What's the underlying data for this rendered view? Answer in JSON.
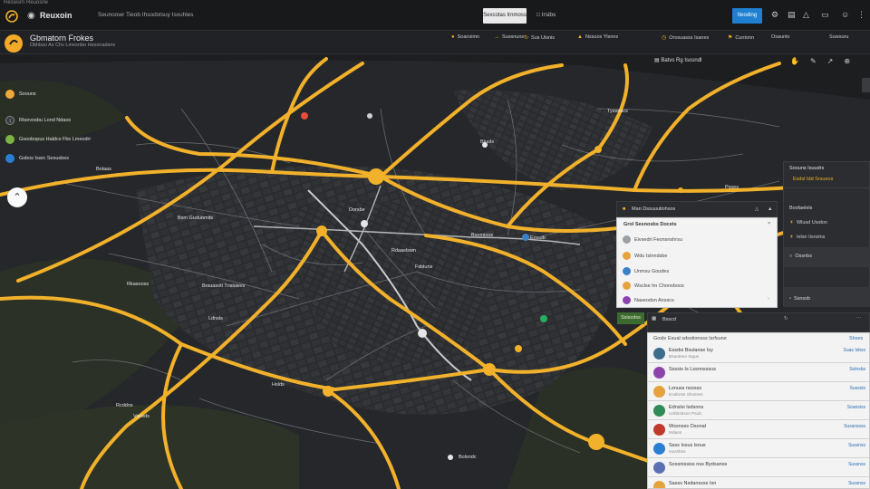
{
  "topbar": {
    "crumb": "Reswsrn Reuosne",
    "app_name": "Reuxoin",
    "subtitle": "Seunoowr Tieob Ihsodstsuy Isxuhles",
    "light_button": "Sexcotas Irnmoss",
    "tab_short": "Irsibs",
    "blue_button": "Iteoding"
  },
  "subheader": {
    "title": "Gbmatorn Frokes",
    "subtitle": "Dbhbso Ax Chv Lmesnbo Hesonadsns",
    "stats": [
      {
        "label": "Soansimn",
        "sub": ""
      },
      {
        "label": "Sussnuns",
        "sub": ""
      },
      {
        "label": "Sus Uisnis",
        "sub": ""
      },
      {
        "label": "Nssuos Ylsnns",
        "sub": ""
      },
      {
        "label": "Orosuasss Isanes",
        "sub": ""
      },
      {
        "label": "Cuntonn",
        "sub": ""
      },
      {
        "label": "Osaunlo",
        "sub": ""
      },
      {
        "label": "Suwsuru",
        "sub": ""
      }
    ]
  },
  "legend": [
    {
      "label": "Soouns",
      "color": "#f2a93b"
    },
    {
      "label": "Rtsevosbu Lond Ndaos",
      "color": "#3a3c40"
    },
    {
      "label": "Gsoobopus Haldcs Fbs Lmeodrr",
      "color": "#7cb342"
    },
    {
      "label": "Gsbos Isarc Sesusbes",
      "color": "#2a7fd4"
    }
  ],
  "map_toolbar": {
    "label": "Batvs Rg  Isosndl"
  },
  "map_labels": {
    "l1": "Bolaas",
    "l2": "Rkasooss",
    "l3": "Brsuasoti Tnsiuwvs",
    "l4": "Ldnsls",
    "l5": "Rcddns",
    "l6": "Vanxds",
    "l7": "Hslds",
    "l8": "Bolsndc",
    "l9": "Fsbluns",
    "l10": "Eosulb",
    "l11": "Bsnmioos",
    "l12": "Rdaaslswn",
    "l13": "Tysseacs",
    "l14": "Bsm Gudubmits",
    "l15": "Psses",
    "l16": "Dorsbe",
    "l17": "Bluols"
  },
  "route_panel": {
    "header": "Man Dssuuutiohsos",
    "title": "Grol Sesnosbs Docets",
    "rows": [
      {
        "label": "Eivsedri Feonsnshrsu",
        "color": "#9aa0a6"
      },
      {
        "label": "Wdu Islnndsbe",
        "color": "#e6a23c"
      },
      {
        "label": "Unmsu Goudes",
        "color": "#3b82c4"
      },
      {
        "label": "Wsclse hn Chonsboos",
        "color": "#e6a23c"
      },
      {
        "label": "Naseodsn Ansscs",
        "color": "#8e44ad"
      }
    ]
  },
  "side_panel": {
    "title": "Soouns Isuudrs",
    "subtitle": "Esdsl Idd  Srsueos",
    "section": "Bosfaelels",
    "rows": [
      {
        "label": "Wlusd Uwdon"
      },
      {
        "label": "Ielsn Iisnslns"
      },
      {
        "label": "Ossnbs"
      },
      {
        "label": "Ssnssb"
      }
    ]
  },
  "list_panel": {
    "tag": "Ssiscdss",
    "tab": "Bsscd",
    "heading_left": "Gosls",
    "heading_mid": "Esual sdsstionsss Isrfsune",
    "heading_right": "Shses",
    "rows": [
      {
        "t1": "Essdsi Bsulanse Isy",
        "t2": "Bsaotsno Ingus",
        "v1": "Suas Isbss",
        "v2": "",
        "color": "#3d6b8c"
      },
      {
        "t1": "Ssssis Is Lssnnsssus",
        "t2": "",
        "v1": "Solnsbs",
        "v2": "",
        "color": "#8e44ad"
      },
      {
        "t1": "Lsnuss nsosss",
        "t2": "Eosboss Shsssss",
        "v1": "Sussnis",
        "v2": "",
        "color": "#e6a23c"
      },
      {
        "t1": "Ednslsi Isdsnns",
        "t2": "Ushbsbsns Psub",
        "v1": "Soansiss",
        "v2": "",
        "color": "#2e8b57"
      },
      {
        "t1": "Wssnsss Osonal",
        "t2": "Mdass",
        "v1": "Sussnssss",
        "v2": "",
        "color": "#c0392b"
      },
      {
        "t1": "Ssss Issus lsnus",
        "t2": "Isussbss",
        "v1": "Sussnss",
        "v2": "",
        "color": "#2a7fd4"
      },
      {
        "t1": "Sossnississ nss Bydsanss",
        "t2": "",
        "v1": "Sussnss",
        "v2": "",
        "color": "#5b6fb5"
      },
      {
        "t1": "Sasss Nsdanssss Isn",
        "t2": "",
        "v1": "Sussnss",
        "v2": "",
        "color": "#e6a23c"
      }
    ]
  },
  "colors": {
    "road": "#f2b12b",
    "street": "#8a8d92",
    "land": "#26282b",
    "green": "#2c3326",
    "accent_blue": "#1f7fd1"
  }
}
